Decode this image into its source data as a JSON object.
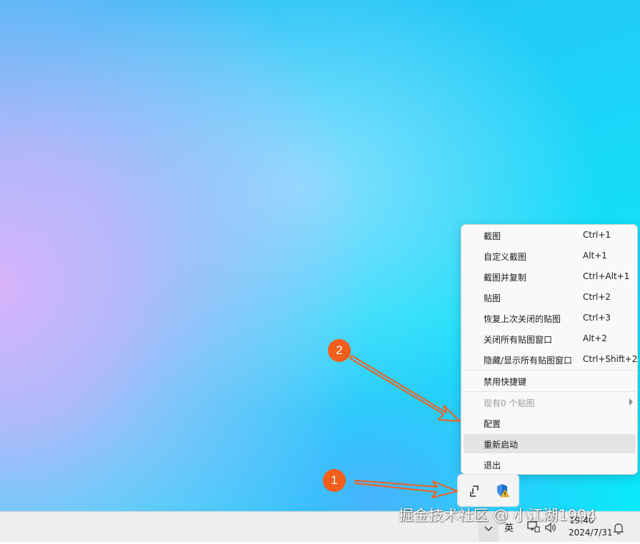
{
  "context_menu": {
    "items": [
      {
        "label": "截图",
        "shortcut": "Ctrl+1"
      },
      {
        "label": "自定义截图",
        "shortcut": "Alt+1"
      },
      {
        "label": "截图并复制",
        "shortcut": "Ctrl+Alt+1"
      },
      {
        "label": "贴图",
        "shortcut": "Ctrl+2"
      },
      {
        "label": "恢复上次关闭的贴图",
        "shortcut": "Ctrl+3"
      },
      {
        "label": "关闭所有贴图窗口",
        "shortcut": "Alt+2"
      },
      {
        "label": "隐藏/显示所有贴图窗口",
        "shortcut": "Ctrl+Shift+2"
      },
      {
        "label": "禁用快捷键"
      },
      {
        "label": "现有0 个贴图",
        "disabled": true,
        "submenu": true
      },
      {
        "label": "配置"
      },
      {
        "label": "重新启动",
        "highlighted": true
      },
      {
        "label": "退出"
      }
    ]
  },
  "tray_flyout": {
    "icons": [
      "snipaste-tray-icon",
      "security-warning-shield-icon"
    ]
  },
  "taskbar": {
    "language": "英",
    "time": "19:40",
    "date": "2024/7/31",
    "icons": [
      "chevron-up-icon",
      "network-icon",
      "volume-icon",
      "notification-bell-icon"
    ]
  },
  "annotations": {
    "step1": "1",
    "step2": "2",
    "arrow_color": "#f25f1c"
  },
  "watermark": "掘金技术社区 @ 小江湖1994"
}
